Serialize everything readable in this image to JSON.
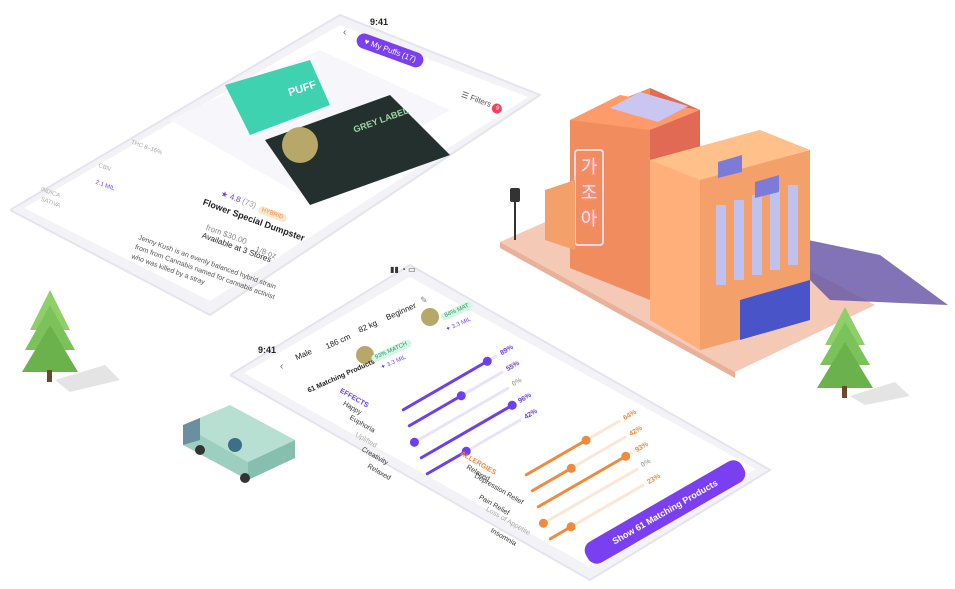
{
  "colors": {
    "primary_purple": "#7b3ff2",
    "effect_fill": "#6c3ff0",
    "allergy_fill": "#f08a3c",
    "match_green": "#1f9b63",
    "puff_banner": "#3fd2b0",
    "building": "#e8735f"
  },
  "phone_products": {
    "time": "9:41",
    "my_puffs_button": "My Puffs (17)",
    "filters_label": "Filters",
    "filters_count": "9",
    "puff_banner": "PUFF",
    "package_label": "GREY LABEL",
    "rating": "4.8",
    "reviews": "(73)",
    "type_tag": "HYBRID",
    "product_name": "Flower Special Dumpster",
    "price": "from $30.00",
    "weight": "1/8 oz",
    "availability": "Available at 3 Stores",
    "description": "Jenny Kush is an evenly balanced hybrid strain from from Cannabis named for cannabis activist who was killed by a stray",
    "side_texts": [
      "THC 8–16%",
      "CBN",
      "INDICA",
      "SATIVA",
      "2.1 MIL"
    ]
  },
  "phone_filters": {
    "time": "9:41",
    "profile": {
      "gender": "Male",
      "height": "186 cm",
      "weight": "82 kg",
      "level": "Beginner"
    },
    "matching_label": "61 Matching Products",
    "match_badge_1": "93% MATCH",
    "match_count_1": "3.3 MIL",
    "match_badge_2": "84% MAT",
    "match_count_2": "3.3 MIL",
    "effects_title": "EFFECTS",
    "effects": [
      {
        "label": "Happy",
        "percent_text": "89%",
        "value": 0.89
      },
      {
        "label": "Euphoria",
        "percent_text": "55%",
        "value": 0.55
      },
      {
        "label": "Uplifted",
        "percent_text": "0%",
        "value": 0.0
      },
      {
        "label": "Creativity",
        "percent_text": "96%",
        "value": 0.96
      },
      {
        "label": "Relaxed",
        "percent_text": "42%",
        "value": 0.42
      }
    ],
    "allergies_title": "ALLERGIES",
    "allergies": [
      {
        "label": "Relaxed",
        "percent_text": "64%",
        "value": 0.64
      },
      {
        "label": "Depression Relief",
        "percent_text": "42%",
        "value": 0.42
      },
      {
        "label": "Pain Relief",
        "percent_text": "93%",
        "value": 0.93
      },
      {
        "label": "Loss of Appetite",
        "percent_text": "0%",
        "value": 0.0
      },
      {
        "label": "Insomnia",
        "percent_text": "23%",
        "value": 0.23
      }
    ],
    "cta_label": "Show 61 Matching Products"
  },
  "building": {
    "sign_text": "가조아"
  }
}
